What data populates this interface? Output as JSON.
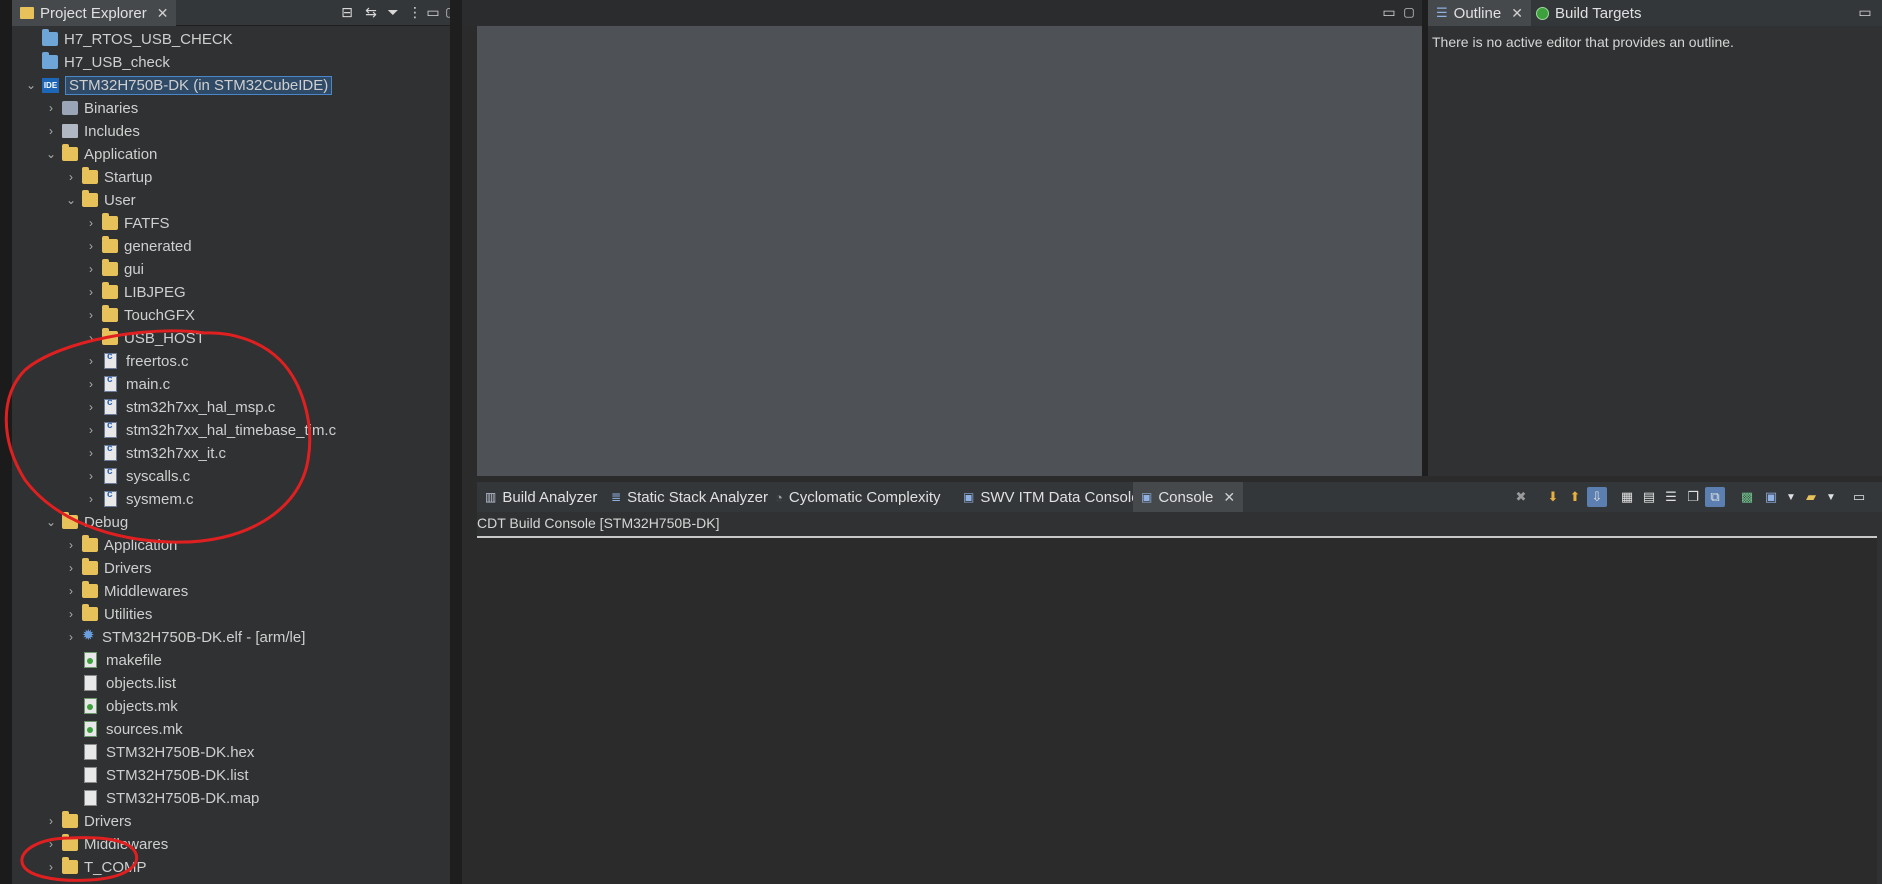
{
  "explorer": {
    "tab_label": "Project Explorer",
    "tree": [
      {
        "label": "H7_RTOS_USB_CHECK",
        "depth": 0,
        "icon": "project-folder-icon",
        "chev": ""
      },
      {
        "label": "H7_USB_check",
        "depth": 0,
        "icon": "project-folder-icon",
        "chev": ""
      },
      {
        "label": "STM32H750B-DK (in STM32CubeIDE)",
        "depth": 0,
        "icon": "ide-project-icon",
        "chev": "v",
        "selected": true
      },
      {
        "label": "Binaries",
        "depth": 1,
        "icon": "binaries-icon",
        "chev": ">"
      },
      {
        "label": "Includes",
        "depth": 1,
        "icon": "includes-icon",
        "chev": ">"
      },
      {
        "label": "Application",
        "depth": 1,
        "icon": "folder-icon",
        "chev": "v"
      },
      {
        "label": "Startup",
        "depth": 2,
        "icon": "folder-icon",
        "chev": ">"
      },
      {
        "label": "User",
        "depth": 2,
        "icon": "folder-icon",
        "chev": "v"
      },
      {
        "label": "FATFS",
        "depth": 3,
        "icon": "folder-icon",
        "chev": ">"
      },
      {
        "label": "generated",
        "depth": 3,
        "icon": "folder-icon",
        "chev": ">"
      },
      {
        "label": "gui",
        "depth": 3,
        "icon": "folder-icon",
        "chev": ">"
      },
      {
        "label": "LIBJPEG",
        "depth": 3,
        "icon": "folder-icon",
        "chev": ">"
      },
      {
        "label": "TouchGFX",
        "depth": 3,
        "icon": "folder-icon",
        "chev": ">"
      },
      {
        "label": "USB_HOST",
        "depth": 3,
        "icon": "folder-icon",
        "chev": ">"
      },
      {
        "label": "freertos.c",
        "depth": 3,
        "icon": "c-file-icon",
        "chev": ">"
      },
      {
        "label": "main.c",
        "depth": 3,
        "icon": "c-file-icon",
        "chev": ">"
      },
      {
        "label": "stm32h7xx_hal_msp.c",
        "depth": 3,
        "icon": "c-file-icon",
        "chev": ">"
      },
      {
        "label": "stm32h7xx_hal_timebase_tim.c",
        "depth": 3,
        "icon": "c-file-icon",
        "chev": ">"
      },
      {
        "label": "stm32h7xx_it.c",
        "depth": 3,
        "icon": "c-file-icon",
        "chev": ">"
      },
      {
        "label": "syscalls.c",
        "depth": 3,
        "icon": "c-file-icon",
        "chev": ">"
      },
      {
        "label": "sysmem.c",
        "depth": 3,
        "icon": "c-file-icon",
        "chev": ">"
      },
      {
        "label": "Debug",
        "depth": 1,
        "icon": "folder-icon",
        "chev": "v"
      },
      {
        "label": "Application",
        "depth": 2,
        "icon": "folder-icon",
        "chev": ">"
      },
      {
        "label": "Drivers",
        "depth": 2,
        "icon": "folder-icon",
        "chev": ">"
      },
      {
        "label": "Middlewares",
        "depth": 2,
        "icon": "folder-icon",
        "chev": ">"
      },
      {
        "label": "Utilities",
        "depth": 2,
        "icon": "folder-icon",
        "chev": ">"
      },
      {
        "label": "STM32H750B-DK.elf - [arm/le]",
        "depth": 2,
        "icon": "elf-binary-icon",
        "chev": ">"
      },
      {
        "label": "makefile",
        "depth": 2,
        "icon": "make-file-icon",
        "chev": ""
      },
      {
        "label": "objects.list",
        "depth": 2,
        "icon": "text-file-icon",
        "chev": ""
      },
      {
        "label": "objects.mk",
        "depth": 2,
        "icon": "make-file-icon",
        "chev": ""
      },
      {
        "label": "sources.mk",
        "depth": 2,
        "icon": "make-file-icon",
        "chev": ""
      },
      {
        "label": "STM32H750B-DK.hex",
        "depth": 2,
        "icon": "text-file-icon",
        "chev": ""
      },
      {
        "label": "STM32H750B-DK.list",
        "depth": 2,
        "icon": "text-file-icon",
        "chev": ""
      },
      {
        "label": "STM32H750B-DK.map",
        "depth": 2,
        "icon": "text-file-icon",
        "chev": ""
      },
      {
        "label": "Drivers",
        "depth": 1,
        "icon": "folder-icon",
        "chev": ">"
      },
      {
        "label": "Middlewares",
        "depth": 1,
        "icon": "folder-icon",
        "chev": ">"
      },
      {
        "label": "T_COMP",
        "depth": 1,
        "icon": "folder-icon",
        "chev": ">"
      }
    ]
  },
  "outline": {
    "tabs": [
      {
        "label": "Outline",
        "close": "✕"
      },
      {
        "label": "Build Targets"
      }
    ],
    "message": "There is no active editor that provides an outline."
  },
  "bottom": {
    "tabs": [
      {
        "label": "Build Analyzer"
      },
      {
        "label": "Static Stack Analyzer"
      },
      {
        "label": "Cyclomatic Complexity"
      },
      {
        "label": "SWV ITM Data Console"
      },
      {
        "label": "Console",
        "close": "✕"
      }
    ],
    "console_title": "CDT Build Console [STM32H750B-DK]"
  },
  "icons": {
    "close": "✕",
    "minimize": "▭",
    "maximize": "▢"
  },
  "colors": {
    "annotation": "#e02020",
    "selection": "#4a86c8",
    "folder": "#e7c15a"
  }
}
